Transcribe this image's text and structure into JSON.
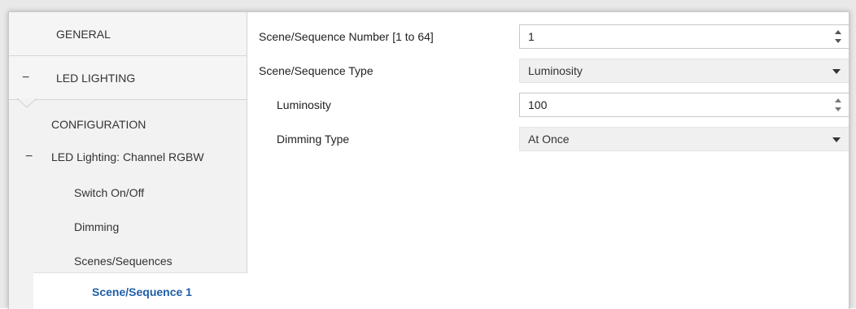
{
  "sidebar": {
    "general": "GENERAL",
    "led_lighting": "LED LIGHTING",
    "configuration": "CONFIGURATION",
    "channel": "LED Lighting: Channel RGBW",
    "switch": "Switch On/Off",
    "dimming": "Dimming",
    "scenes": "Scenes/Sequences",
    "selected": "Scene/Sequence 1",
    "collapse_glyph": "−"
  },
  "form": {
    "number_label": "Scene/Sequence Number [1 to 64]",
    "number_value": "1",
    "type_label": "Scene/Sequence Type",
    "type_value": "Luminosity",
    "luminosity_label": "Luminosity",
    "luminosity_value": "100",
    "luminosity_unit": "%",
    "dimming_label": "Dimming Type",
    "dimming_value": "At Once"
  },
  "colors": {
    "accent": "#1f5fa8",
    "sidebar_bg": "#f2f2f2",
    "select_bg": "#f0f0f0"
  },
  "icons": {
    "spinner": "spinner-icon",
    "dropdown": "chevron-down-icon",
    "collapse": "minus-icon"
  }
}
